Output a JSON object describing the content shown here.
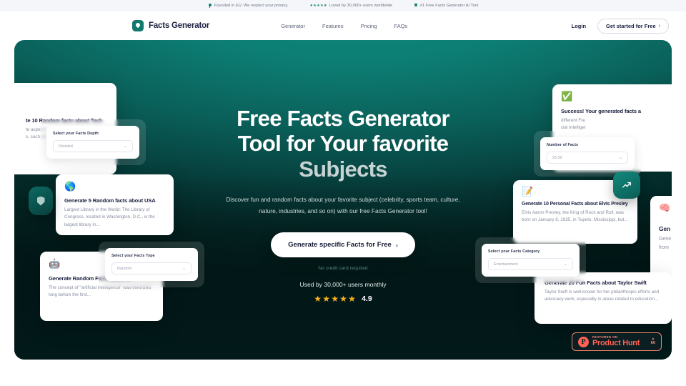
{
  "topbar": {
    "items": [
      {
        "icon": "eu-privacy-icon",
        "text": "Founded in EU. We respect your privacy."
      },
      {
        "icon": "stars-icon",
        "stars": "★★★★★",
        "text": "Loved by 30,000+ users worldwide"
      },
      {
        "icon": "trophy-icon",
        "text": "#1 Free Facts Generator AI Tool"
      }
    ]
  },
  "nav": {
    "brand": "Facts Generator",
    "logo_icon": "lightbulb-icon",
    "links": [
      "Generator",
      "Features",
      "Pricing",
      "FAQs"
    ],
    "login_label": "Login",
    "cta_label": "Get started for Free",
    "cta_chevron": "›"
  },
  "hero": {
    "headline_line1": "Free Facts Generator",
    "headline_line2": "Tool for Your favorite",
    "headline_line3": "Subjects",
    "subhead": "Discover fun and random facts about your favorite subject (celebrity, sports team, culture, nature, industries, and so on) with our free Facts Generator tool!",
    "cta_label": "Generate specific Facts for Free",
    "cta_chevron": "›",
    "no_credit_card": "No credit card required",
    "used_by": "Used by 30,000+ users monthly",
    "stars": "★★★★★",
    "rating": "4.9",
    "accent_color": "#0e7d6f",
    "bg_top_color": "#0f8d81",
    "bg_bottom_color": "#02191a"
  },
  "cards": [
    {
      "name": "tech-facts-card",
      "emoji": "",
      "title": "te 10 Random facts about Tech",
      "body_line1": "te aspects o",
      "body_line2": "s, such as in"
    },
    {
      "name": "usa-facts-card",
      "emoji": "🌎",
      "title": "Generate 5 Random facts about USA",
      "body": "Largest Library in the World: The Library of Congress, located in Washington, D.C., is the largest library in..."
    },
    {
      "name": "ai-facts-card",
      "emoji": "🤖",
      "title": "Generate Random Facts about AI",
      "body": "The concept of \"artificial intelligence\" was theorized long before the first..."
    },
    {
      "name": "success-card",
      "emoji": "✅",
      "title": "Success! Your generated facts a",
      "body_line1": "different Fre",
      "body_line2": "cial Intelliger"
    },
    {
      "name": "elvis-facts-card",
      "emoji": "📝",
      "title": "Generate 10 Personal Facts about Elvis Presley",
      "body": "Elvis Aaron Presley, the King of Rock and Roll, was born on January 8, 1935, in Tupelo, Mississippi, but..."
    },
    {
      "name": "taylor-swift-facts-card",
      "emoji": "",
      "title": "Generate 20 Fun Facts about Taylor Swift",
      "body": "Taylor Swift is well-known for her philanthropic efforts and advocacy work, especially in areas related to education..."
    },
    {
      "name": "brain-facts-card",
      "emoji": "🧠",
      "title": "Gen",
      "body_line1": "Gene",
      "body_line2": "from"
    }
  ],
  "panels": [
    {
      "name": "facts-depth-panel",
      "label": "Select your Facts Depth",
      "value": "Detailed",
      "arrow": "⌄"
    },
    {
      "name": "facts-type-panel",
      "label": "Select your Facts Type",
      "value": "Random",
      "arrow": "⌄"
    },
    {
      "name": "number-of-facts-panel",
      "label": "Number of Facts",
      "value": "25-30",
      "arrow": "⌄"
    },
    {
      "name": "facts-category-panel",
      "label": "Select your Facts Category",
      "value": "Entertainment",
      "arrow": "⌄"
    }
  ],
  "product_hunt": {
    "letter": "P",
    "featured_on": "FEATURED ON",
    "name": "Product Hunt",
    "arrow": "▲",
    "count": "60"
  }
}
